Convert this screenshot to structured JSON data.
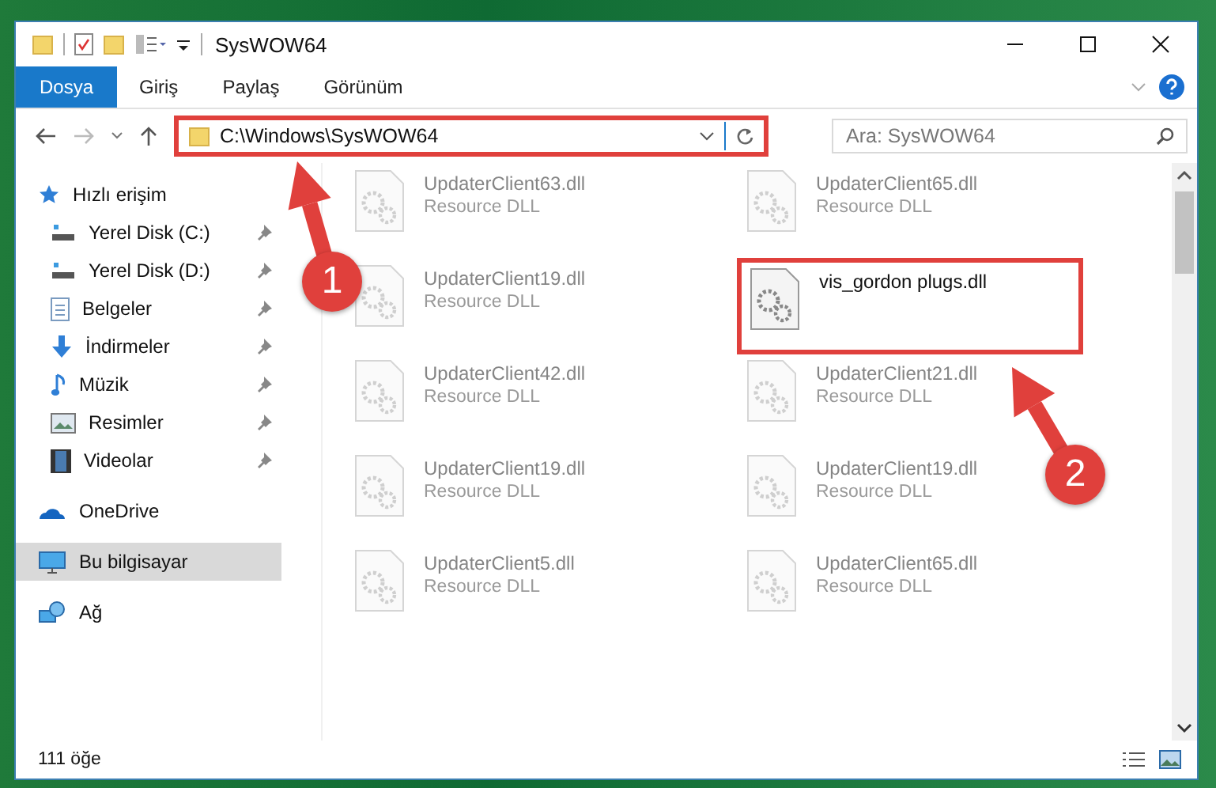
{
  "window": {
    "title": "SysWOW64"
  },
  "ribbon_tabs": [
    {
      "label": "Dosya",
      "selected": true
    },
    {
      "label": "Giriş",
      "selected": false
    },
    {
      "label": "Paylaş",
      "selected": false
    },
    {
      "label": "Görünüm",
      "selected": false
    }
  ],
  "address_bar": {
    "path": "C:\\Windows\\SysWOW64",
    "highlighted": true
  },
  "search": {
    "placeholder": "Ara: SysWOW64"
  },
  "sidebar": {
    "items": [
      {
        "label": "Hızlı erişim",
        "kind": "star",
        "selected": false,
        "children": [
          {
            "label": "Yerel Disk (C:)",
            "kind": "drive",
            "pinned": true,
            "selected": false
          },
          {
            "label": "Yerel Disk (D:)",
            "kind": "drive",
            "pinned": true,
            "selected": false
          },
          {
            "label": "Belgeler",
            "kind": "documents",
            "pinned": true,
            "selected": false
          },
          {
            "label": "İndirmeler",
            "kind": "download",
            "pinned": true,
            "selected": false
          },
          {
            "label": "Müzik",
            "kind": "music",
            "pinned": true,
            "selected": false
          },
          {
            "label": "Resimler",
            "kind": "pictures",
            "pinned": true,
            "selected": false
          },
          {
            "label": "Videolar",
            "kind": "videos",
            "pinned": true,
            "selected": false
          }
        ]
      },
      {
        "label": "OneDrive",
        "kind": "cloud",
        "selected": false
      },
      {
        "label": "Bu bilgisayar",
        "kind": "computer",
        "selected": true
      },
      {
        "label": "Ağ",
        "kind": "network",
        "selected": false
      }
    ]
  },
  "files": [
    {
      "name": "UpdaterClient63.dll",
      "type": "Resource DLL",
      "dimmed": true,
      "highlighted": false
    },
    {
      "name": "UpdaterClient65.dll",
      "type": "Resource DLL",
      "dimmed": true,
      "highlighted": false
    },
    {
      "name": "UpdaterClient19.dll",
      "type": "Resource DLL",
      "dimmed": true,
      "highlighted": false
    },
    {
      "name": "vis_gordon plugs.dll",
      "dimmed": false,
      "highlighted": true
    },
    {
      "name": "UpdaterClient42.dll",
      "type": "Resource DLL",
      "dimmed": true,
      "highlighted": false
    },
    {
      "name": "UpdaterClient21.dll",
      "type": "Resource DLL",
      "dimmed": true,
      "highlighted": false
    },
    {
      "name": "UpdaterClient19.dll",
      "type": "Resource DLL",
      "dimmed": true,
      "highlighted": false
    },
    {
      "name": "UpdaterClient19.dll",
      "type": "Resource DLL",
      "dimmed": true,
      "highlighted": false
    },
    {
      "name": "UpdaterClient5.dll",
      "type": "Resource DLL",
      "dimmed": true,
      "highlighted": false
    },
    {
      "name": "UpdaterClient65.dll",
      "type": "Resource DLL",
      "dimmed": true,
      "highlighted": false
    }
  ],
  "status_bar": {
    "count": "111 öğe"
  },
  "annotations": [
    {
      "label": "1"
    },
    {
      "label": "2"
    }
  ]
}
